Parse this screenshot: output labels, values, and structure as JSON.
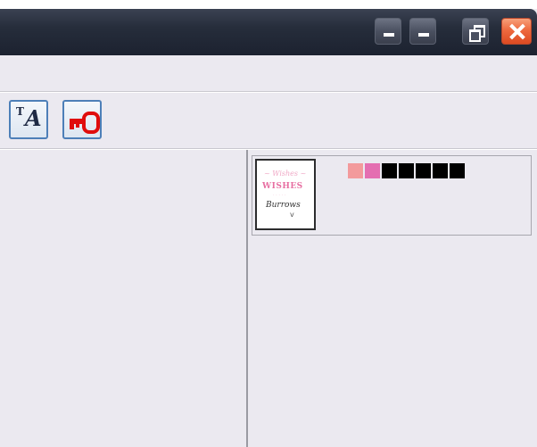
{
  "window": {
    "titlebar": {
      "buttons": [
        {
          "name": "minimize-button-1",
          "icon": "minimize-icon"
        },
        {
          "name": "minimize-button-2",
          "icon": "minimize-icon"
        },
        {
          "name": "restore-button",
          "icon": "restore-icon"
        },
        {
          "name": "close-button",
          "icon": "close-icon",
          "color": "#ee6a3f"
        }
      ]
    },
    "toolbar": {
      "buttons": [
        {
          "name": "text-format-button",
          "icon": "text-format-icon",
          "label_small": "T",
          "label_big": "A"
        },
        {
          "name": "key-button",
          "icon": "key-icon",
          "color": "#e00d0d"
        }
      ]
    },
    "preview": {
      "thumbnail": {
        "line1": "~ Wishes ~",
        "line2": "WISHES",
        "line3": "· · · · ·",
        "line4": "Burrows",
        "line5": "v"
      },
      "palette": [
        "#f39a9c",
        "#e46eb1",
        "#000000",
        "#000000",
        "#000000",
        "#000000",
        "#000000"
      ]
    }
  }
}
